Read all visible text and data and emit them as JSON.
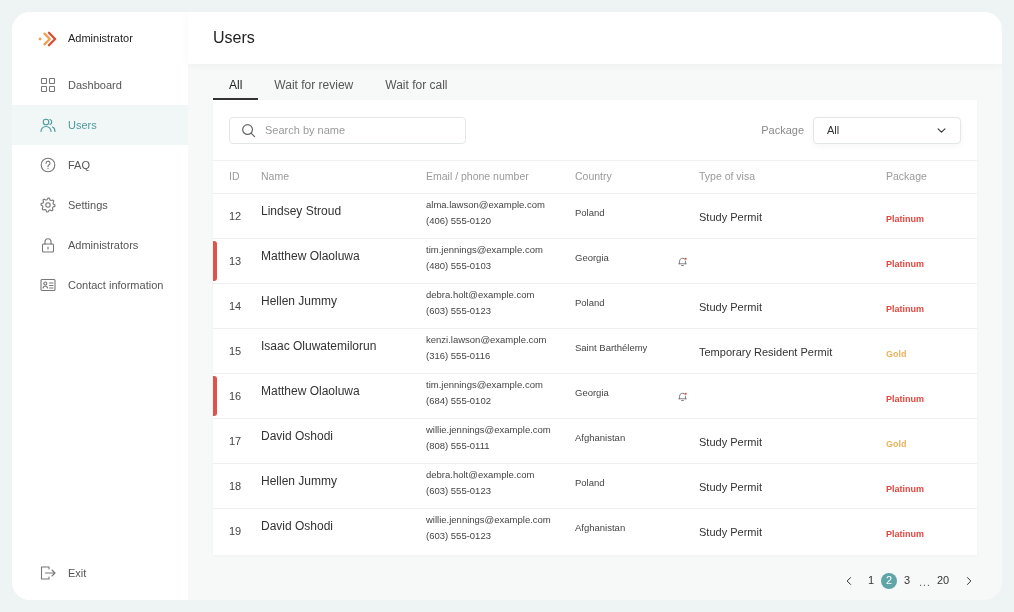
{
  "sidebar": {
    "title": "Administrator",
    "items": [
      {
        "label": "Dashboard",
        "selected": false
      },
      {
        "label": "Users",
        "selected": true
      },
      {
        "label": "FAQ",
        "selected": false
      },
      {
        "label": "Settings",
        "selected": false
      },
      {
        "label": "Administrators",
        "selected": false
      },
      {
        "label": "Contact information",
        "selected": false
      }
    ],
    "exit": "Exit"
  },
  "header": {
    "title": "Users"
  },
  "tabs": [
    {
      "label": "All",
      "selected": true
    },
    {
      "label": "Wait for review",
      "selected": false
    },
    {
      "label": "Wait for call",
      "selected": false
    }
  ],
  "search": {
    "placeholder": "Search by name"
  },
  "package_filter": {
    "label": "Package",
    "value": "All"
  },
  "table": {
    "columns": [
      "ID",
      "Name",
      "Email / phone number",
      "Country",
      "Type of visa",
      "Package"
    ],
    "rows": [
      {
        "id": "12",
        "name": "Lindsey Stroud",
        "email": "alma.lawson@example.com",
        "phone": "(406) 555-0120",
        "country": "Poland",
        "visa": "Study Permit",
        "package": {
          "label": "Platinum",
          "color": "#e0473f"
        },
        "flagged": false,
        "notification": false
      },
      {
        "id": "13",
        "name": "Matthew Olaoluwa",
        "email": "tim.jennings@example.com",
        "phone": "(480) 555-0103",
        "country": "Georgia",
        "package": {
          "label": "Platinum",
          "color": "#e0473f"
        },
        "flagged": true,
        "notification": true
      },
      {
        "id": "14",
        "name": "Hellen Jummy",
        "email": "debra.holt@example.com",
        "phone": "(603) 555-0123",
        "country": "Poland",
        "visa": "Study Permit",
        "package": {
          "label": "Platinum",
          "color": "#e0473f"
        },
        "flagged": false,
        "notification": false
      },
      {
        "id": "15",
        "name": "Isaac Oluwatemilorun",
        "email": "kenzi.lawson@example.com",
        "phone": "(316) 555-0116",
        "country": "Saint Barthélemy",
        "visa": "Temporary Resident Permit",
        "package": {
          "label": "Gold",
          "color": "#e9b25e"
        },
        "flagged": false,
        "notification": false
      },
      {
        "id": "16",
        "name": "Matthew Olaoluwa",
        "email": "tim.jennings@example.com",
        "phone": "(684) 555-0102",
        "country": "Georgia",
        "package": {
          "label": "Platinum",
          "color": "#e0473f"
        },
        "flagged": true,
        "notification": true
      },
      {
        "id": "17",
        "name": "David Oshodi",
        "email": "willie.jennings@example.com",
        "phone": "(808) 555-0111",
        "country": "Afghanistan",
        "visa": "Study Permit",
        "package": {
          "label": "Gold",
          "color": "#e9b25e"
        },
        "flagged": false,
        "notification": false
      },
      {
        "id": "18",
        "name": "Hellen Jummy",
        "email": "debra.holt@example.com",
        "phone": "(603) 555-0123",
        "country": "Poland",
        "visa": "Study Permit",
        "package": {
          "label": "Platinum",
          "color": "#e0473f"
        },
        "flagged": false,
        "notification": false
      },
      {
        "id": "19",
        "name": "David Oshodi",
        "email": "willie.jennings@example.com",
        "phone": "(603) 555-0123",
        "country": "Afghanistan",
        "visa": "Study Permit",
        "package": {
          "label": "Platinum",
          "color": "#e0473f"
        },
        "flagged": false,
        "notification": false
      }
    ]
  },
  "pagination": {
    "items": [
      {
        "kind": "page",
        "label": "1",
        "selected": false
      },
      {
        "kind": "page",
        "label": "2",
        "selected": true
      },
      {
        "kind": "page",
        "label": "3",
        "selected": false
      },
      {
        "kind": "ellipsis",
        "label": "...",
        "selected": false
      },
      {
        "kind": "page",
        "label": "20",
        "selected": false
      }
    ]
  }
}
